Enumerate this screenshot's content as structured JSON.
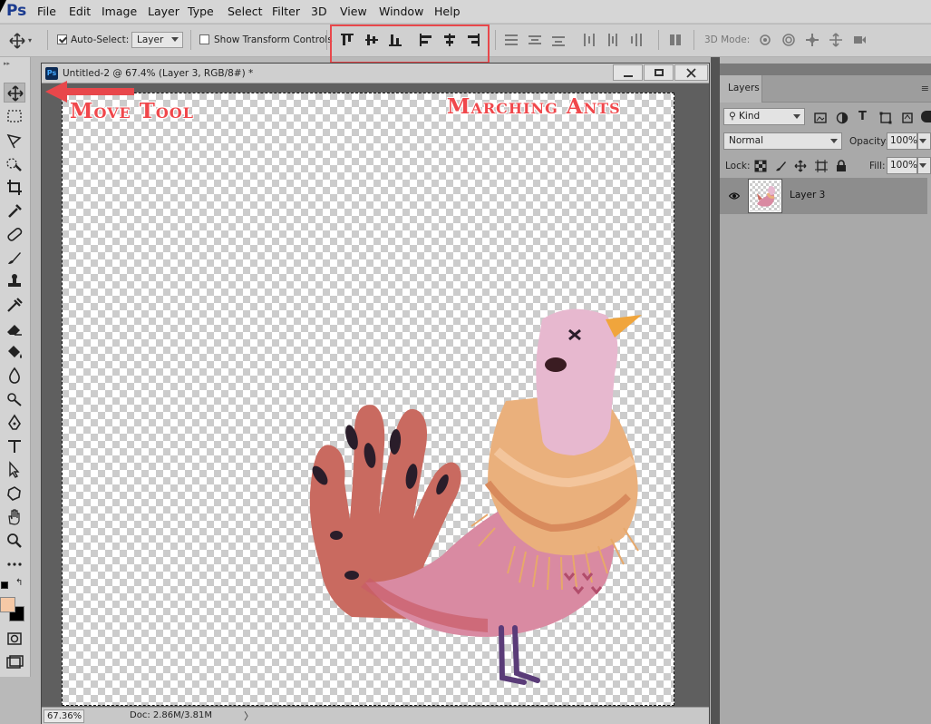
{
  "app": {
    "logo": "Ps"
  },
  "menu": [
    "File",
    "Edit",
    "Image",
    "Layer",
    "Type",
    "Select",
    "Filter",
    "3D",
    "View",
    "Window",
    "Help"
  ],
  "options": {
    "auto_select_label": "Auto-Select:",
    "auto_select_checked": true,
    "auto_select_value": "Layer",
    "transform_label": "Show Transform Controls",
    "transform_checked": false,
    "mode_3d_label": "3D Mode:"
  },
  "document": {
    "title": "Untitled-2 @ 67.4% (Layer 3, RGB/8#) *",
    "zoom_status": "67.36%",
    "doc_size": "Doc: 2.86M/3.81M",
    "status_arrow": "〉"
  },
  "annotations": {
    "move_tool": "Move Tool",
    "marching_ants": "Marching Ants"
  },
  "colors": {
    "foreground": "#f6c9a6",
    "background": "#000000",
    "annotation": "#f0474b"
  },
  "layers_panel": {
    "tab": "Layers",
    "filter_value": "Kind",
    "blend_mode": "Normal",
    "opacity_label": "Opacity:",
    "opacity_value": "100%",
    "lock_label": "Lock:",
    "fill_label": "Fill:",
    "fill_value": "100%",
    "layers": [
      {
        "name": "Layer 3",
        "visible": true
      }
    ]
  }
}
